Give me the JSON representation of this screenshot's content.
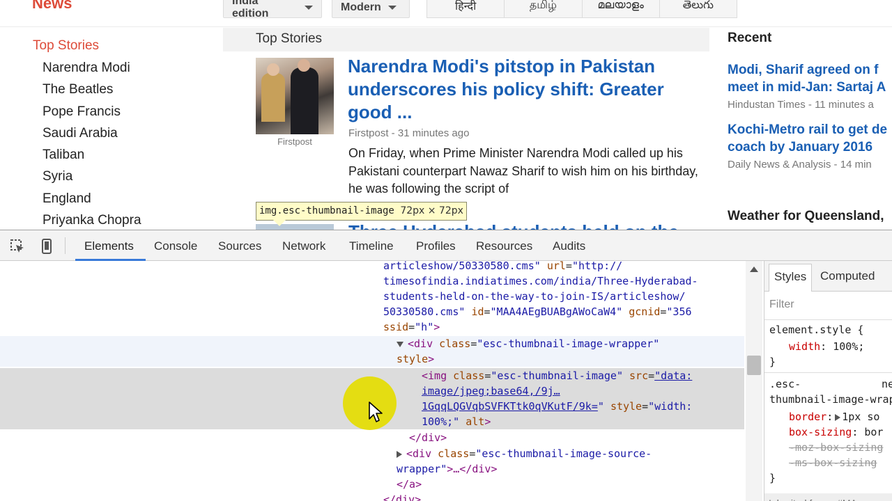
{
  "news_header": {
    "brand": "News",
    "edition_label": "India edition",
    "view_label": "Modern",
    "languages": [
      "हिन्दी",
      "தமிழ்",
      "മലയാളം",
      "తెలుగు"
    ]
  },
  "left_nav": {
    "heading": "Top Stories",
    "items": [
      "Narendra Modi",
      "The Beatles",
      "Pope Francis",
      "Saudi Arabia",
      "Taliban",
      "Syria",
      "England",
      "Priyanka Chopra"
    ]
  },
  "main": {
    "section_title": "Top Stories",
    "story": {
      "thumb_source": "Firstpost",
      "title": "Narendra Modi's pitstop in Pakistan underscores his policy shift: Greater good ...",
      "source": "Firstpost",
      "time": "31 minutes ago",
      "snippet": "On Friday, when Prime Minister Narendra Modi called up his Pakistani counterpart Nawaz Sharif to wish him on his birthday, he was following the script of"
    },
    "story2_title": "Three Hyderabad students held on the"
  },
  "tooltip": {
    "selector": "img.esc-thumbnail-image",
    "dimensions": "72px × 72px"
  },
  "recent": {
    "title": "Recent",
    "items": [
      {
        "title_line1": "Modi, Sharif agreed on f",
        "title_line2": "meet in mid-Jan: Sartaj A",
        "source": "Hindustan Times",
        "time": "11 minutes a"
      },
      {
        "title_line1": "Kochi-Metro rail to get de",
        "title_line2": "coach by January 2016",
        "source": "Daily News & Analysis",
        "time": "14 min"
      }
    ],
    "weather": "Weather for Queensland,"
  },
  "devtools": {
    "tabs": [
      "Elements",
      "Console",
      "Sources",
      "Network",
      "Timeline",
      "Profiles",
      "Resources",
      "Audits"
    ],
    "active_tab": "Elements",
    "code": {
      "l1_val": "articleshow/50330580.cms\"",
      "l1_attr": "url",
      "l1_val2": "\"http://",
      "l2": "timesofindia.indiatimes.com/india/Three-Hyderabad-",
      "l3": "students-held-on-the-way-to-join-IS/articleshow/",
      "l4_val": "50330580.cms\"",
      "l4_attr": "id",
      "l4_val2": "\"MAA4AEgBUABgAWoCaW4\"",
      "l4_attr2": "gcnid",
      "l4_val3": "\"356",
      "l5_attr": "ssid",
      "l5_val": "\"h\"",
      "l5_end": ">",
      "div_tag": "<div",
      "div_attr": "class",
      "div_val": "\"esc-thumbnail-image-wrapper\"",
      "div_style": "style",
      "div_end": ">",
      "img_tag": "<img",
      "img_attr": "class",
      "img_val": "\"esc-thumbnail-image\"",
      "img_src_attr": "src",
      "img_src_1": "\"data:",
      "img_src_2": "image/jpeg;base64,/9j…",
      "img_src_3": "1GqqLQGVqbSVFKTtk0qVKutF/9k=",
      "img_src_end": "\"",
      "img_style_attr": "style",
      "img_style_val": "\"width:",
      "img_style_val2": "100%;\"",
      "img_alt": "alt",
      "img_end": ">",
      "close_div": "</div>",
      "div2_tag": "<div",
      "div2_attr": "class",
      "div2_val": "\"esc-thumbnail-image-source-",
      "div2_val2": "wrapper\"",
      "div2_rest": ">…</div>",
      "close_a": "</a>",
      "close_div2": "</div>"
    },
    "styles": {
      "tabs": [
        "Styles",
        "Computed"
      ],
      "filter_placeholder": "Filter",
      "rule1_selector": "element.style {",
      "rule1_prop": "width",
      "rule1_val": "100%;",
      "rule1_close": "}",
      "rule2_selector1": ".esc-",
      "rule2_source": "ne",
      "rule2_selector2": "thumbnail-image-wrapper",
      "rule2_p1": "border",
      "rule2_v1": "1px so",
      "rule2_p2": "box-sizing",
      "rule2_v2": "bor",
      "rule2_p3": "-moz-box-sizing",
      "rule2_p4": "-ms-box-sizing",
      "rule2_close": "}",
      "inherited": "Inherited from a#MA"
    }
  }
}
